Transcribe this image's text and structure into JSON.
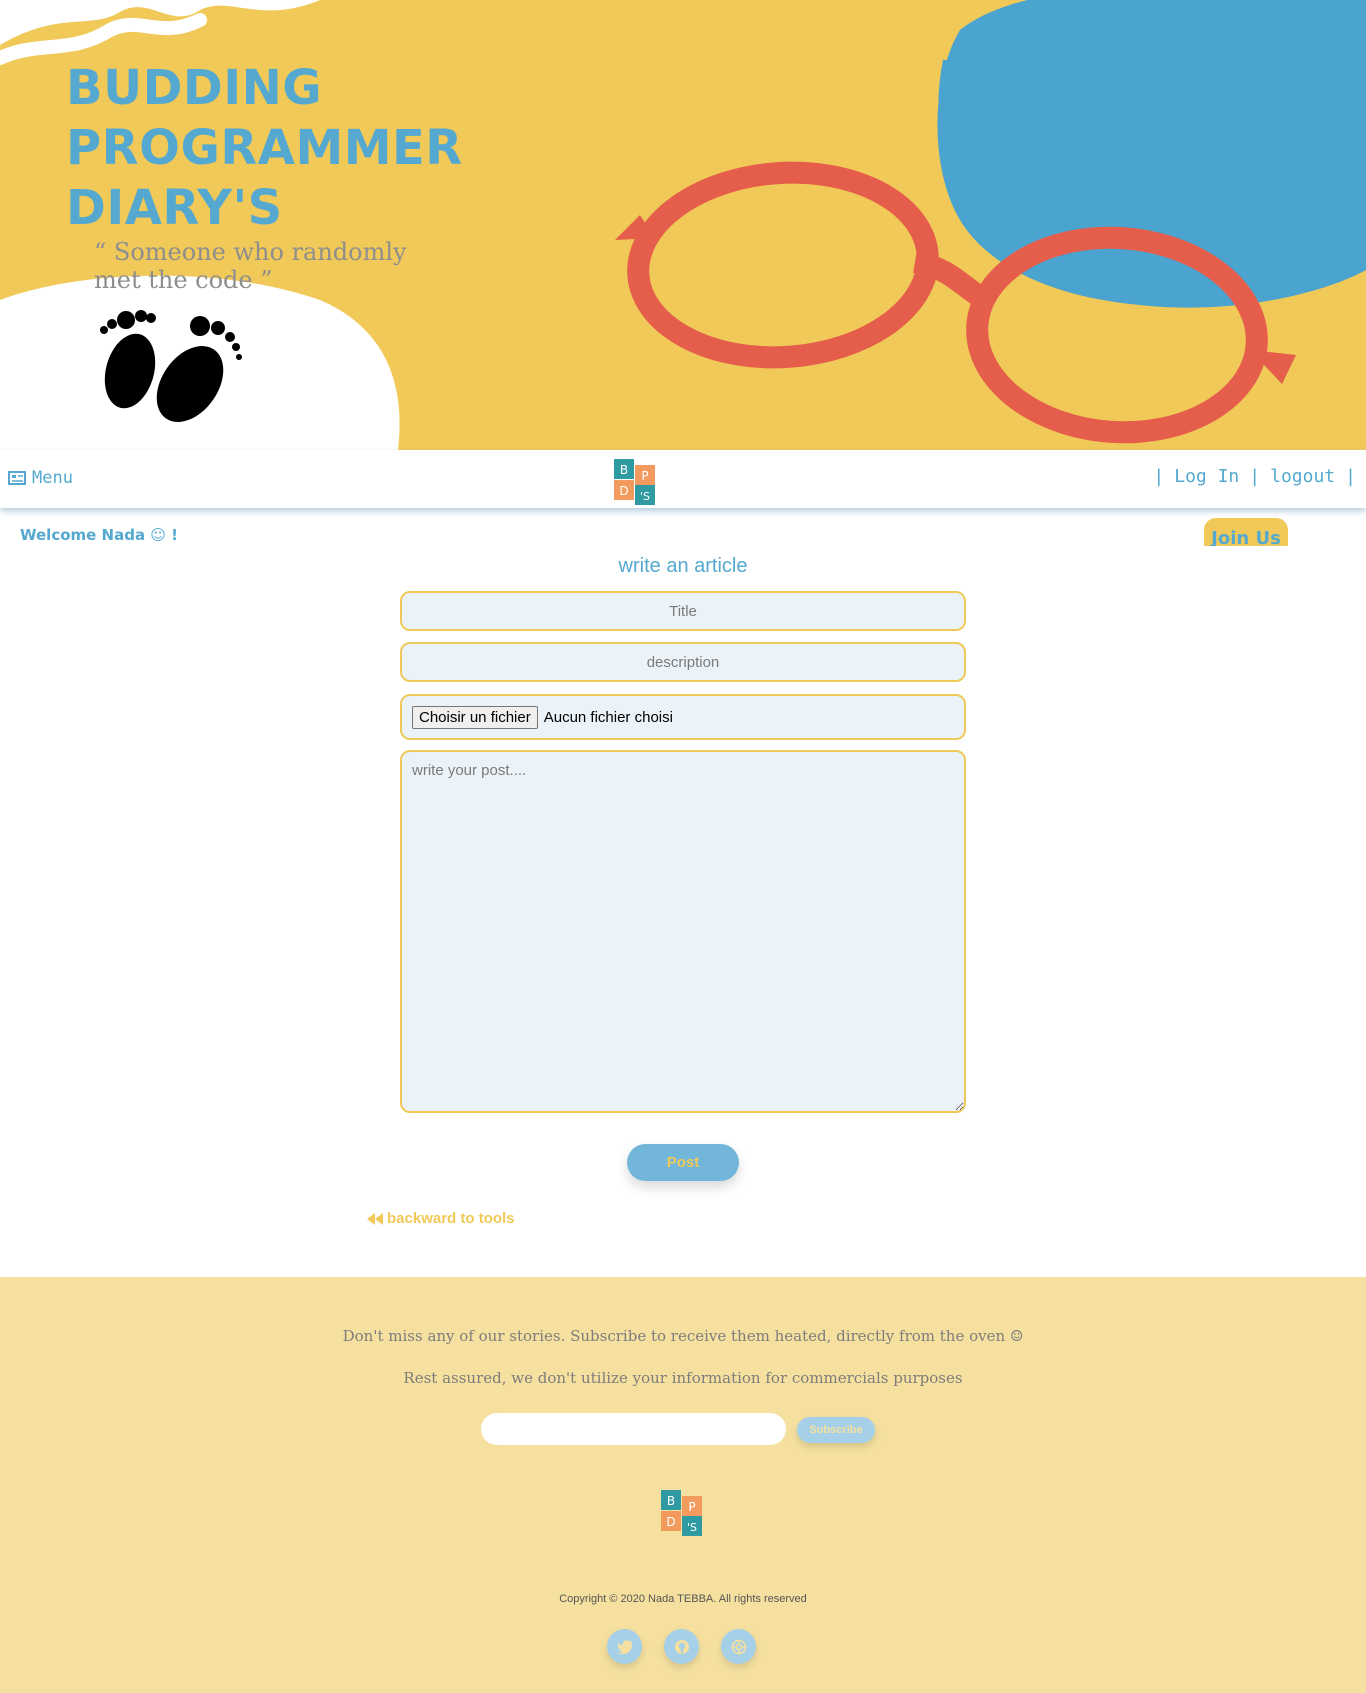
{
  "hero": {
    "title": "BUDDING PROGRAMMER DIARY'S",
    "tagline": "“ Someone who randomly met the code ”",
    "colors": {
      "background": "#f0c958",
      "accent": "#55a9d0",
      "glasses": "#e55e4b"
    }
  },
  "nav": {
    "menu_label": "Menu",
    "menu_icon": "newspaper-icon",
    "logo_letters": [
      "B",
      "P",
      "D",
      "'S"
    ],
    "separator": "|",
    "login_label": "Log In",
    "logout_label": "logout"
  },
  "welcome_text": "Welcome Nada ☺ !",
  "join_us_label": "Join Us",
  "form": {
    "title": "write an article",
    "title_placeholder": "Title",
    "description_placeholder": "description",
    "file_button_label": "Choisir un fichier",
    "file_status": "Aucun fichier choisi",
    "post_placeholder": "write your post....",
    "post_button_label": "Post",
    "back_link_label": "backward to tools"
  },
  "footer": {
    "line1": "Don't miss any of our stories. Subscribe to receive them heated, directly from the oven ☺",
    "line2": "Rest assured, we don't utilize your information for commercials purposes",
    "email_value": "",
    "subscribe_label": "Subscribe",
    "copyright": "Copyright © 2020 Nada TEBBA. All rights reserved",
    "socials": [
      {
        "name": "twitter-icon"
      },
      {
        "name": "github-icon"
      },
      {
        "name": "website-icon"
      }
    ],
    "colors": {
      "background": "#f5e09f",
      "button": "#a5d0e8"
    }
  }
}
